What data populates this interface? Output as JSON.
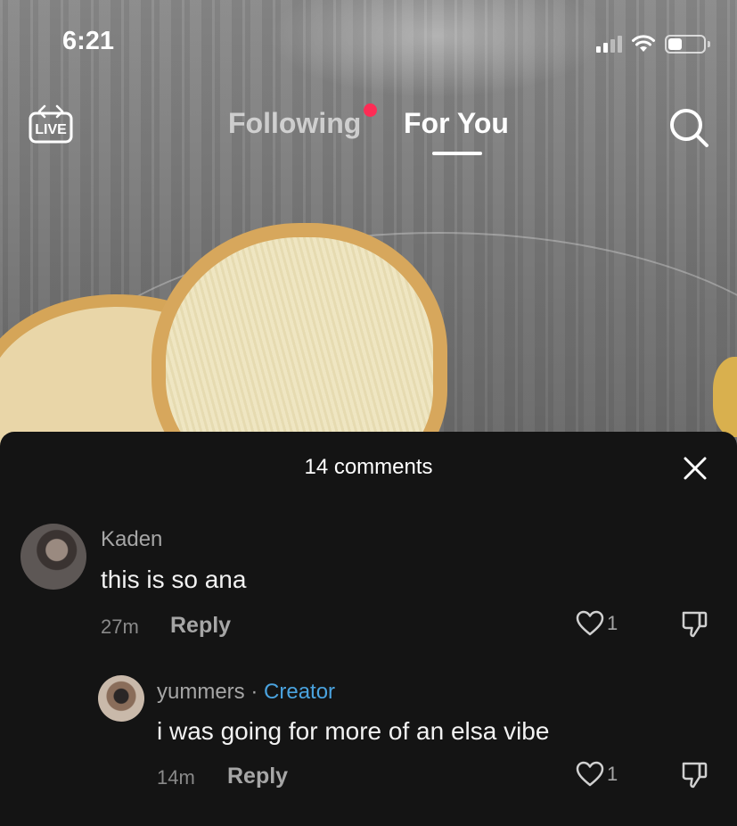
{
  "status_bar": {
    "time": "6:21"
  },
  "nav": {
    "live_icon_text": "LIVE",
    "tabs": [
      {
        "label": "Following"
      },
      {
        "label": "For You"
      }
    ]
  },
  "comments_sheet": {
    "title": "14 comments",
    "comments": [
      {
        "username": "Kaden",
        "text": "this is so ana",
        "time": "27m",
        "reply_label": "Reply",
        "likes": "1"
      },
      {
        "username": "yummers",
        "separator": "·",
        "tag": "Creator",
        "text": "i was going for more of an elsa vibe",
        "time": "14m",
        "reply_label": "Reply",
        "likes": "1"
      }
    ]
  },
  "colors": {
    "accent_red": "#fe2c55",
    "creator_blue": "#4aa3df",
    "sheet_bg": "#141414"
  },
  "icons": [
    "live-icon",
    "search-icon",
    "close-icon",
    "heart-icon",
    "dislike-icon",
    "wifi-icon",
    "signal-icon",
    "battery-icon"
  ]
}
